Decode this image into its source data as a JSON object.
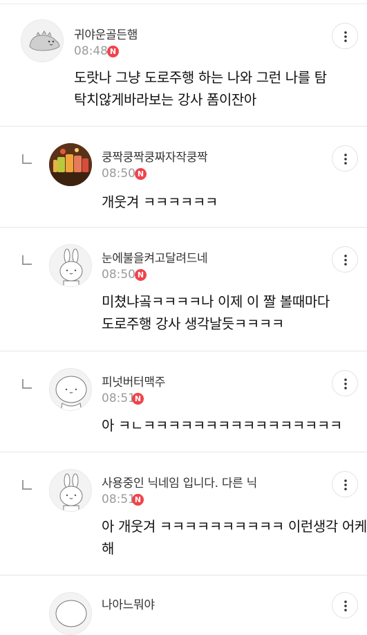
{
  "comments": [
    {
      "nickname": "귀야운골든햄",
      "time": "08:48",
      "badge": "N",
      "text_lines": [
        "도랏나 그냥 도로주행 하는 나와 그런 나를 탐",
        "탁치않게바라보는 강사 폼이잔아"
      ],
      "avatar": "dinosaur-avatar",
      "reply": false
    },
    {
      "nickname": "쿵짝쿵짝쿵짜자작쿵짝",
      "time": "08:50",
      "badge": "N",
      "text_lines": [
        "개웃겨 ㅋㅋㅋㅋㅋㅋ"
      ],
      "avatar": "drinks-photo-avatar",
      "reply": true
    },
    {
      "nickname": "눈에불을켜고달려드네",
      "time": "08:50",
      "badge": "N",
      "text_lines": [
        "미쳤냐곸ㅋㅋㅋㅋ나 이제 이 짤 볼때마다",
        "도로주행 강사 생각날듯ㅋㅋㅋㅋ"
      ],
      "avatar": "rabbit-avatar",
      "reply": true
    },
    {
      "nickname": "피넛버터맥주",
      "time": "08:51",
      "badge": "N",
      "text_lines": [
        "아 ㅋㄴㅋㅋㅋㅋㅋㅋㅋㅋㅋㅋㅋㅋㅋㅋㅋㅋ"
      ],
      "avatar": "round-face-avatar",
      "reply": true
    },
    {
      "nickname": "사용중인 닉네임 입니다. 다른 닉",
      "time": "08:51",
      "badge": "N",
      "text_lines": [
        "아 개웃겨 ㅋㅋㅋㅋㅋㅋㅋㅋㅋㅋ 이런생각 어케",
        "해"
      ],
      "avatar": "rabbit-avatar",
      "reply": true
    },
    {
      "nickname": "나아느뭐야",
      "time": "",
      "badge": "",
      "text_lines": [],
      "avatar": "round-face-avatar",
      "reply": true
    }
  ],
  "colors": {
    "badge": "#f0434a",
    "divider": "#e6e6e6",
    "time": "#9b9b9b"
  }
}
